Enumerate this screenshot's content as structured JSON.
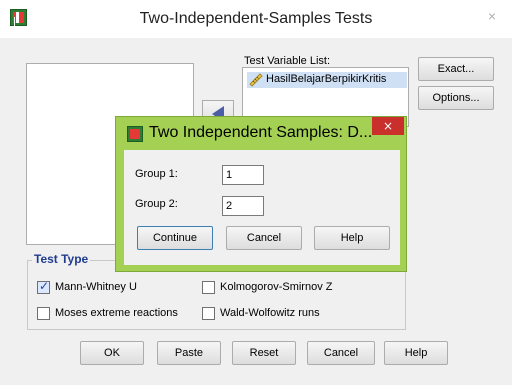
{
  "window": {
    "title": "Two-Independent-Samples Tests",
    "close_symbol": "×"
  },
  "test_variable_list": {
    "label": "Test Variable List:",
    "items": [
      "HasilBelajarBerpikirKritis"
    ]
  },
  "side_buttons": {
    "exact": "Exact...",
    "options": "Options..."
  },
  "test_type": {
    "label": "Test Type",
    "mann_whitney": {
      "label": "Mann-Whitney U",
      "checked": true
    },
    "kolmogorov": {
      "label": "Kolmogorov-Smirnov Z",
      "checked": false
    },
    "moses": {
      "label": "Moses extreme reactions",
      "checked": false
    },
    "wald": {
      "label": "Wald-Wolfowitz runs",
      "checked": false
    }
  },
  "bottom_buttons": {
    "ok": "OK",
    "paste": "Paste",
    "reset": "Reset",
    "cancel": "Cancel",
    "help": "Help"
  },
  "dialog": {
    "title": "Two Independent Samples: D...",
    "close_symbol": "×",
    "group1": {
      "label": "Group 1:",
      "value": "1"
    },
    "group2": {
      "label": "Group 2:",
      "value": "2"
    },
    "buttons": {
      "continue": "Continue",
      "cancel": "Cancel",
      "help": "Help"
    }
  }
}
